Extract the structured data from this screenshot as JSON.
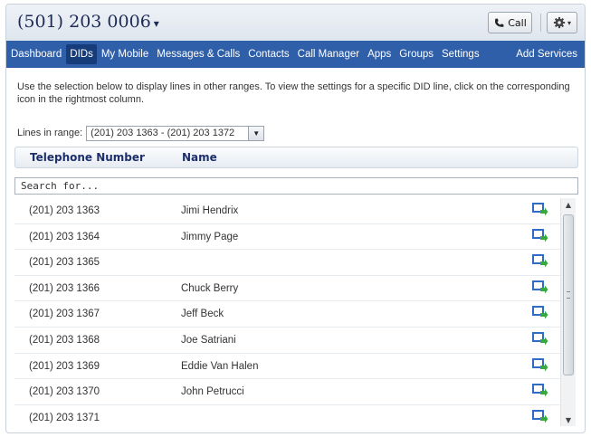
{
  "header": {
    "phone": "(501) 203 0006",
    "caret": "▾",
    "call_label": "Call",
    "gear_caret": "▾"
  },
  "nav": {
    "items": [
      "Dashboard",
      "DIDs",
      "My Mobile",
      "Messages & Calls",
      "Contacts",
      "Call Manager",
      "Apps",
      "Groups",
      "Settings",
      "Add Services"
    ],
    "active": "DIDs"
  },
  "intro": "Use the selection below to display lines in other ranges. To view the settings for a specific DID line, click on the corresponding icon in the rightmost column.",
  "range": {
    "label": "Lines in range:",
    "value": "(201) 203 1363 - (201) 203 1372"
  },
  "table": {
    "columns": [
      "Telephone Number",
      "Name"
    ],
    "search_placeholder": "Search for...",
    "rows": [
      {
        "number": "(201) 203 1363",
        "name": "Jimi Hendrix"
      },
      {
        "number": "(201) 203 1364",
        "name": "Jimmy Page"
      },
      {
        "number": "(201) 203 1365",
        "name": ""
      },
      {
        "number": "(201) 203 1366",
        "name": "Chuck Berry"
      },
      {
        "number": "(201) 203 1367",
        "name": "Jeff Beck"
      },
      {
        "number": "(201) 203 1368",
        "name": "Joe Satriani"
      },
      {
        "number": "(201) 203 1369",
        "name": "Eddie Van Halen"
      },
      {
        "number": "(201) 203 1370",
        "name": "John Petrucci"
      },
      {
        "number": "(201) 203 1371",
        "name": ""
      }
    ],
    "row_icon": "line-settings-icon"
  },
  "colors": {
    "nav_bg": "#2f5fa9",
    "nav_active": "#173c7a",
    "header_text": "#1c2f6b",
    "icon_blue": "#2f6cc4",
    "icon_green": "#3aa840"
  }
}
